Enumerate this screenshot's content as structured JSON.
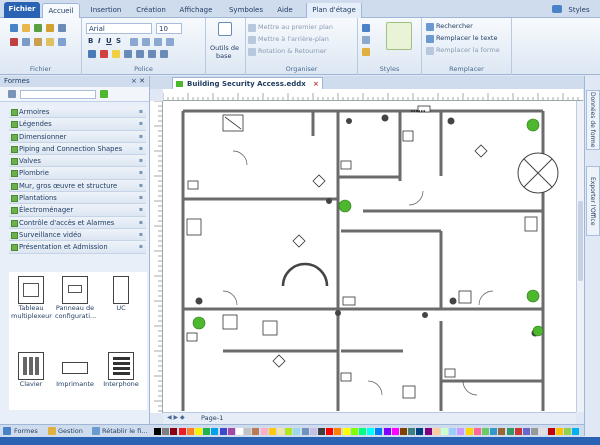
{
  "tabs": {
    "file": "Fichier",
    "home": "Accueil",
    "insert": "Insertion",
    "create": "Création",
    "view": "Affichage",
    "symbols": "Symboles",
    "help": "Aide",
    "layout": "Plan d'étage",
    "styles": "Styles"
  },
  "ribbon": {
    "font_name": "Arial",
    "font_size": "10",
    "group_file": "Fichier",
    "group_font": "Police",
    "tool_label_1": "Outils de",
    "tool_label_2": "base",
    "arrange_1": "Mettre au premier plan",
    "arrange_2": "Mettre à l'arrière-plan",
    "arrange_3": "Rotation & Retourner",
    "group_arrange": "Organiser",
    "group_styles": "Styles",
    "search": "Rechercher",
    "replace_text": "Remplacer le texte",
    "replace_shape": "Remplacer la forme",
    "group_replace": "Remplacer"
  },
  "left_panel": {
    "title": "Formes",
    "categories": [
      "Armoires",
      "Légendes",
      "Dimensionner",
      "Piping and Connection Shapes",
      "Valves",
      "Plombrie",
      "Mur, gros œuvre et structure",
      "Plantations",
      "Électroménager",
      "Contrôle d'accès et Alarmes",
      "Surveillance vidéo",
      "Présentation et Admission"
    ],
    "shapes": [
      {
        "label1": "Tableau",
        "label2": "multiplexeur"
      },
      {
        "label1": "Panneau de",
        "label2": "configurati..."
      },
      {
        "label1": "UC",
        "label2": ""
      },
      {
        "label1": "Clavier",
        "label2": ""
      },
      {
        "label1": "Imprimante",
        "label2": ""
      },
      {
        "label1": "Interphone",
        "label2": ""
      }
    ],
    "bottom_tab_1": "Formes",
    "bottom_tab_2": "Gestion",
    "bottom_tab_3": "Rétablir le fi..."
  },
  "document": {
    "tab_title": "Building Security Access.eddx",
    "page_tab": "Page-1"
  },
  "right_panel": {
    "tab1": "Données de forme",
    "tab2": "Exporter l'Office"
  },
  "palette_colors": [
    "#000000",
    "#7f7f7f",
    "#880015",
    "#ed1c24",
    "#ff7f27",
    "#fff200",
    "#22b14c",
    "#00a2e8",
    "#3f48cc",
    "#a349a4",
    "#ffffff",
    "#c3c3c3",
    "#b97a57",
    "#ffaec9",
    "#ffc90e",
    "#efe4b0",
    "#b5e61d",
    "#99d9ea",
    "#7092be",
    "#c8bfe7",
    "#404040",
    "#ff0000",
    "#ff8000",
    "#ffff00",
    "#80ff00",
    "#00ff80",
    "#00ffff",
    "#0080ff",
    "#8000ff",
    "#ff00ff",
    "#804000",
    "#408080",
    "#004080",
    "#800080",
    "#ffcc99",
    "#ccffcc",
    "#99ccff",
    "#cc99ff",
    "#ffd700",
    "#ff6699",
    "#66cc66",
    "#3399cc",
    "#996633",
    "#339966",
    "#cc3333",
    "#6666cc",
    "#999999",
    "#e0e0e0",
    "#c00000",
    "#ffc000",
    "#92d050",
    "#00b0f0"
  ],
  "colors": {
    "accent": "#2b63b4",
    "plant": "#4db82e",
    "wall": "#666666"
  }
}
